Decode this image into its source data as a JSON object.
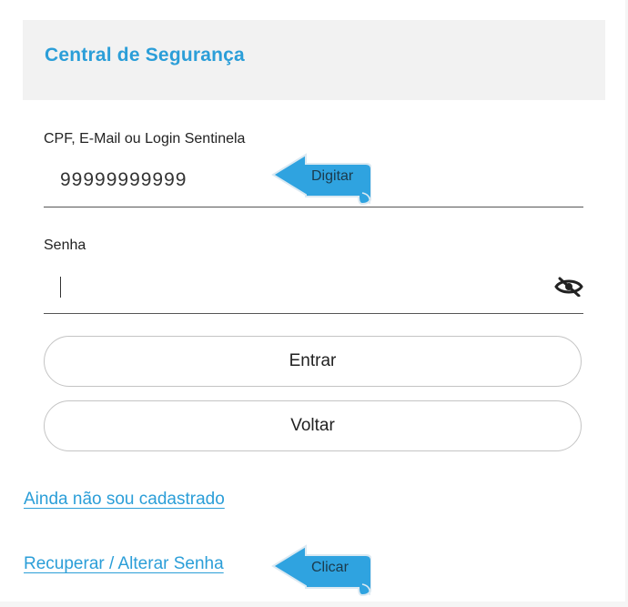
{
  "header": {
    "title": "Central de Segurança"
  },
  "login": {
    "user_label": "CPF, E-Mail ou Login Sentinela",
    "user_value": "99999999999",
    "password_label": "Senha",
    "password_value": ""
  },
  "buttons": {
    "enter": "Entrar",
    "back": "Voltar"
  },
  "links": {
    "register": "Ainda não sou cadastrado",
    "recover": "Recuperar / Alterar Senha"
  },
  "annotations": {
    "type_hint": "Digitar",
    "click_hint": "Clicar"
  },
  "colors": {
    "accent": "#2b9ed8",
    "hint_fill": "#2fa3e0",
    "header_bg": "#f2f2f2"
  },
  "icons": {
    "password_toggle": "eye-slash-icon"
  }
}
